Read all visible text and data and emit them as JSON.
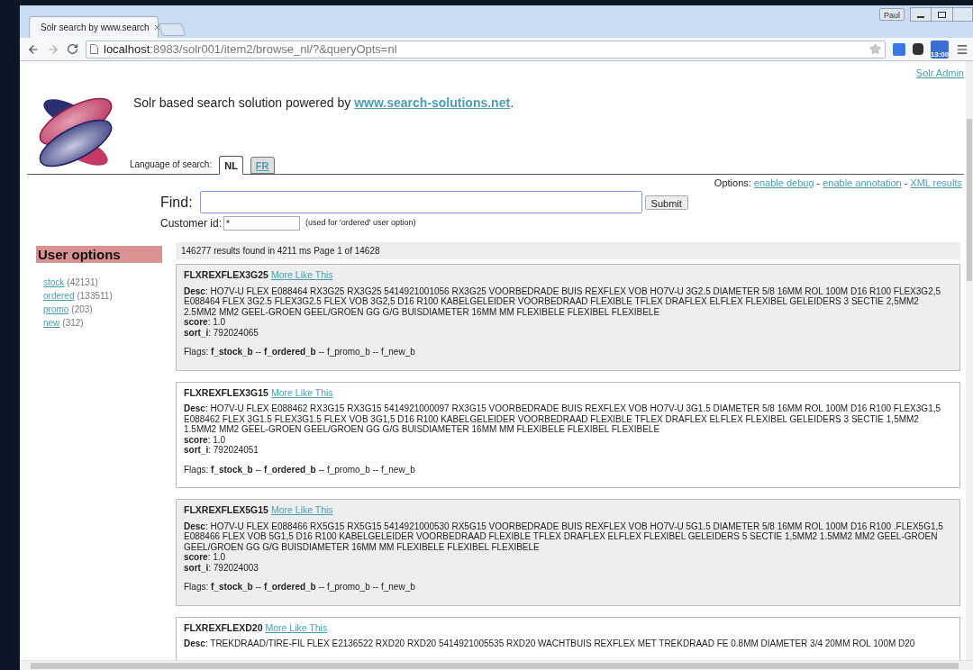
{
  "browser": {
    "tab_title": "Solr search by www.search",
    "url_host": "localhost",
    "url_rest": ":8983/solr001/item2/browse_nl/?&queryOpts=nl",
    "profile": "Paul",
    "extension_badge": "13:00"
  },
  "header": {
    "admin_link": "Solr Admin",
    "tagline_prefix": "Solr based search solution powered by ",
    "tagline_link": "www.search-solutions.net",
    "tagline_suffix": ".",
    "language_label": "Language of search:",
    "languages": [
      {
        "label": "NL",
        "selected": true
      },
      {
        "label": "FR",
        "selected": false
      }
    ]
  },
  "options": {
    "label": "Options:",
    "links": [
      "enable debug",
      "enable annotation",
      "XML results"
    ],
    "separator": "-"
  },
  "search": {
    "find_label": "Find:",
    "submit": "Submit",
    "customer_label": "Customer id:",
    "customer_value": "*",
    "customer_hint": "(used for 'ordered' user option)"
  },
  "sidebar": {
    "title": "User options",
    "facets": [
      {
        "label": "stock",
        "count": "(42131)"
      },
      {
        "label": "ordered",
        "count": "(133511)"
      },
      {
        "label": "promo",
        "count": "(203)"
      },
      {
        "label": "new",
        "count": "(312)"
      }
    ]
  },
  "results": {
    "summary": "146277 results found in 4211 ms Page 1 of 14628",
    "items": [
      {
        "title": "FLXREXFLEX3G25",
        "more_link": "More Like This",
        "fields": [
          "**Desc**: HO7V-U FLEX E088464 RX3G25 RX3G25 5414921001056 RX3G25 VOORBEDRADE BUIS REXFLEX VOB HO7V-U 3G2.5 DIAMETER 5/8 16MM ROL 100M D16 R100 FLEX3G2,5 E088464 FLEX 3G2.5 FLEX3G2.5 FLEX VOB 3G2,5 D16 R100 KABELGELEIDER VOORBEDRAAD FLEXIBLE TFLEX DRAFLEX ELFLEX FLEXIBEL GELEIDERS 3 SECTIE 2,5MM2 2.5MM2 MM2 GEEL-GROEN GEEL/GROEN GG G/G BUISDIAMETER 16MM MM FLEXIBELE FLEXIBEL FLEXIBELE",
          "**score**: 1.0",
          "**sort_i**: 792024065"
        ],
        "flags_label": "Flags:",
        "flag_separator": "--",
        "flags": [
          {
            "name": "f_stock_b",
            "on": true
          },
          {
            "name": "f_ordered_b",
            "on": true
          },
          {
            "name": "f_promo_b",
            "on": false
          },
          {
            "name": "f_new_b",
            "on": false
          }
        ]
      },
      {
        "title": "FLXREXFLEX3G15",
        "more_link": "More Like This",
        "fields": [
          "**Desc**: HO7V-U FLEX E088462 RX3G15 RX3G15 5414921000097 RX3G15 VOORBEDRADE BUIS REXFLEX VOB HO7V-U 3G1.5 DIAMETER 5/8 16MM ROL 100M D16 R100 FLEX3G1,5 E088462 FLEX 3G1.5 FLEX3G1.5 FLEX VOB 3G1,5 D16 R100 KABELGELEIDER VOORBEDRAAD FLEXIBLE TFLEX DRAFLEX ELFLEX FLEXIBEL GELEIDERS 3 SECTIE 1,5MM2 1.5MM2 MM2 GEEL-GROEN GEEL/GROEN GG G/G BUISDIAMETER 16MM MM FLEXIBELE FLEXIBEL FLEXIBELE",
          "**score**: 1.0",
          "**sort_i**: 792024051"
        ],
        "flags_label": "Flags:",
        "flag_separator": "--",
        "flags": [
          {
            "name": "f_stock_b",
            "on": true
          },
          {
            "name": "f_ordered_b",
            "on": true
          },
          {
            "name": "f_promo_b",
            "on": false
          },
          {
            "name": "f_new_b",
            "on": false
          }
        ]
      },
      {
        "title": "FLXREXFLEX5G15",
        "more_link": "More Like This",
        "fields": [
          "**Desc**: HO7V-U FLEX E088466 RX5G15 RX5G15 5414921000530 RX5G15 VOORBEDRADE BUIS REXFLEX VOB HO7V-U 5G1.5 DIAMETER 5/8 16MM ROL 100M D16 R100 .FLEX5G1,5 E088466 FLEX VOB 5G1,5 D16 R100 KABELGELEIDER VOORBEDRAAD FLEXIBLE TFLEX DRAFLEX ELFLEX FLEXIBEL GELEIDERS 5 SECTIE 1,5MM2 1.5MM2 MM2 GEEL-GROEN GEEL/GROEN GG G/G BUISDIAMETER 16MM MM FLEXIBELE FLEXIBEL FLEXIBELE",
          "**score**: 1.0",
          "**sort_i**: 792024003"
        ],
        "flags_label": "Flags:",
        "flag_separator": "--",
        "flags": [
          {
            "name": "f_stock_b",
            "on": true
          },
          {
            "name": "f_ordered_b",
            "on": true
          },
          {
            "name": "f_promo_b",
            "on": false
          },
          {
            "name": "f_new_b",
            "on": false
          }
        ]
      },
      {
        "title": "FLXREXFLEXD20",
        "more_link": "More Like This",
        "fields": [
          "**Desc**: TREKDRAAD/TIRE-FIL FLEX E2136522 RXD20 RXD20 5414921005535 RXD20 WACHTBUIS REXFLEX MET TREKDRAAD FE 0.8MM DIAMETER 3/4 20MM ROL 100M D20"
        ]
      }
    ]
  }
}
